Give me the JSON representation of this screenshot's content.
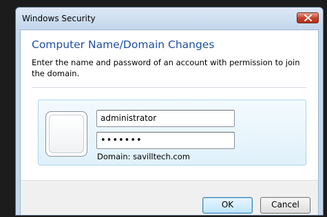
{
  "window": {
    "title": "Windows Security",
    "close_icon": "close-x-icon"
  },
  "dialog": {
    "heading": "Computer Name/Domain Changes",
    "description": "Enter the name and password of an account with permission to join the domain."
  },
  "credentials": {
    "user_tile_icon": "user-tile-icon",
    "username_value": "administrator",
    "password_masked": "•••••••",
    "domain_text": "Domain: savilltech.com"
  },
  "buttons": {
    "ok_label": "OK",
    "cancel_label": "Cancel"
  },
  "colors": {
    "heading": "#1e4fa0",
    "frame": "#c6d9ee",
    "close_button": "#c43d26",
    "credential_panel": "#e0f1fb"
  }
}
